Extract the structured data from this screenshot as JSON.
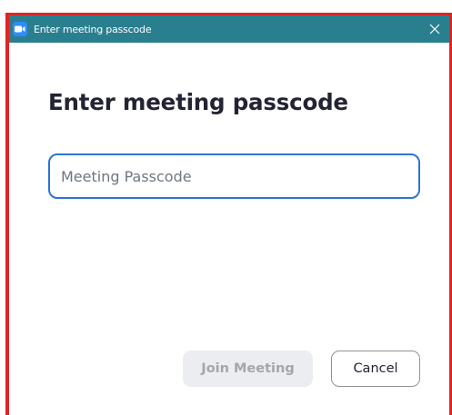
{
  "window": {
    "title": "Enter meeting passcode",
    "titlebar_color": "#2a7f8f",
    "icon": "zoom-camera-icon",
    "close_icon": "close-icon"
  },
  "dialog": {
    "heading": "Enter meeting passcode",
    "passcode_input": {
      "value": "",
      "placeholder": "Meeting Passcode"
    },
    "buttons": {
      "join_label": "Join Meeting",
      "join_enabled": false,
      "cancel_label": "Cancel"
    }
  },
  "colors": {
    "accent": "#2d73d9",
    "highlight_border": "#e02424",
    "disabled_button_bg": "#ecedf1"
  }
}
